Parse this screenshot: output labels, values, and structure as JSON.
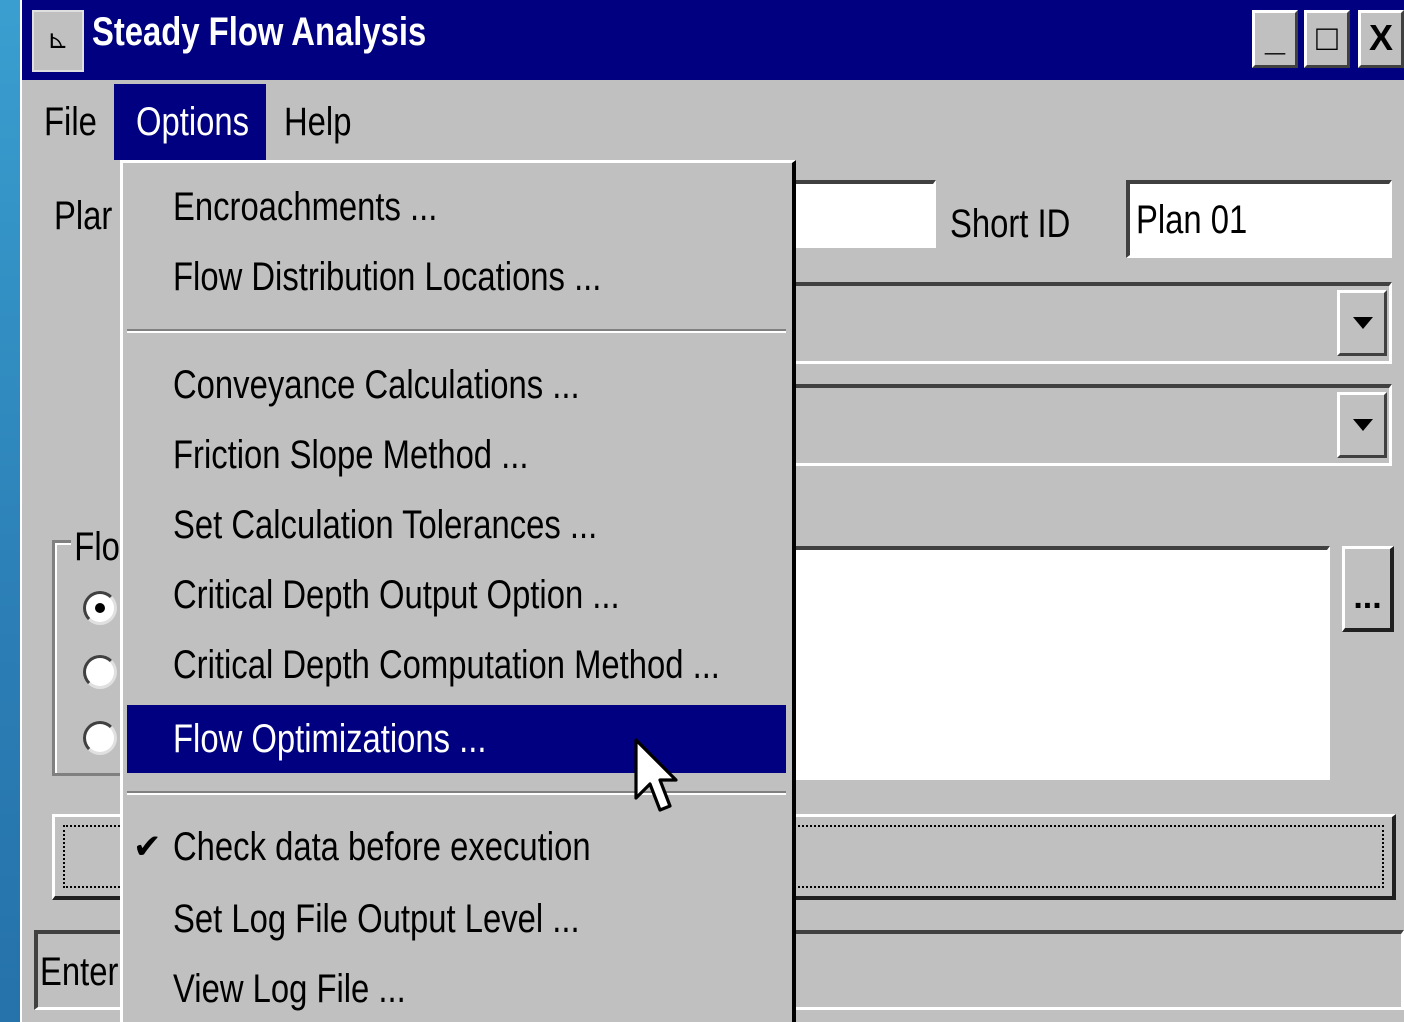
{
  "window": {
    "title": "Steady Flow Analysis",
    "sys_icon": "⊾"
  },
  "caption_buttons": {
    "minimize": "_",
    "maximize": "□",
    "close": "X"
  },
  "menubar": {
    "file": "File",
    "options": "Options",
    "help": "Help"
  },
  "form": {
    "plan_label_partial": "Plar",
    "short_id_label": "Short ID",
    "short_id_value": "Plan 01",
    "flow_group_partial": "Flo",
    "browse_button": "...",
    "status_partial": "Enter"
  },
  "options_menu": {
    "items": [
      {
        "label": "Encroachments ..."
      },
      {
        "label": "Flow Distribution Locations ..."
      },
      {
        "label": "Conveyance Calculations ..."
      },
      {
        "label": "Friction Slope Method ..."
      },
      {
        "label": "Set Calculation Tolerances ..."
      },
      {
        "label": "Critical Depth Output Option ..."
      },
      {
        "label": "Critical Depth Computation Method ..."
      },
      {
        "label": "Flow Optimizations ..."
      },
      {
        "label": "Check data before execution",
        "checked": true
      },
      {
        "label": "Set Log File Output Level ..."
      },
      {
        "label": "View Log File ..."
      }
    ],
    "highlighted_item": "Flow Optimizations ...",
    "check_mark": "✔"
  },
  "colors": {
    "titlebar": "#000080",
    "face": "#c0c0c0",
    "highlight": "#000080",
    "desktop": "#2b7fb6"
  }
}
